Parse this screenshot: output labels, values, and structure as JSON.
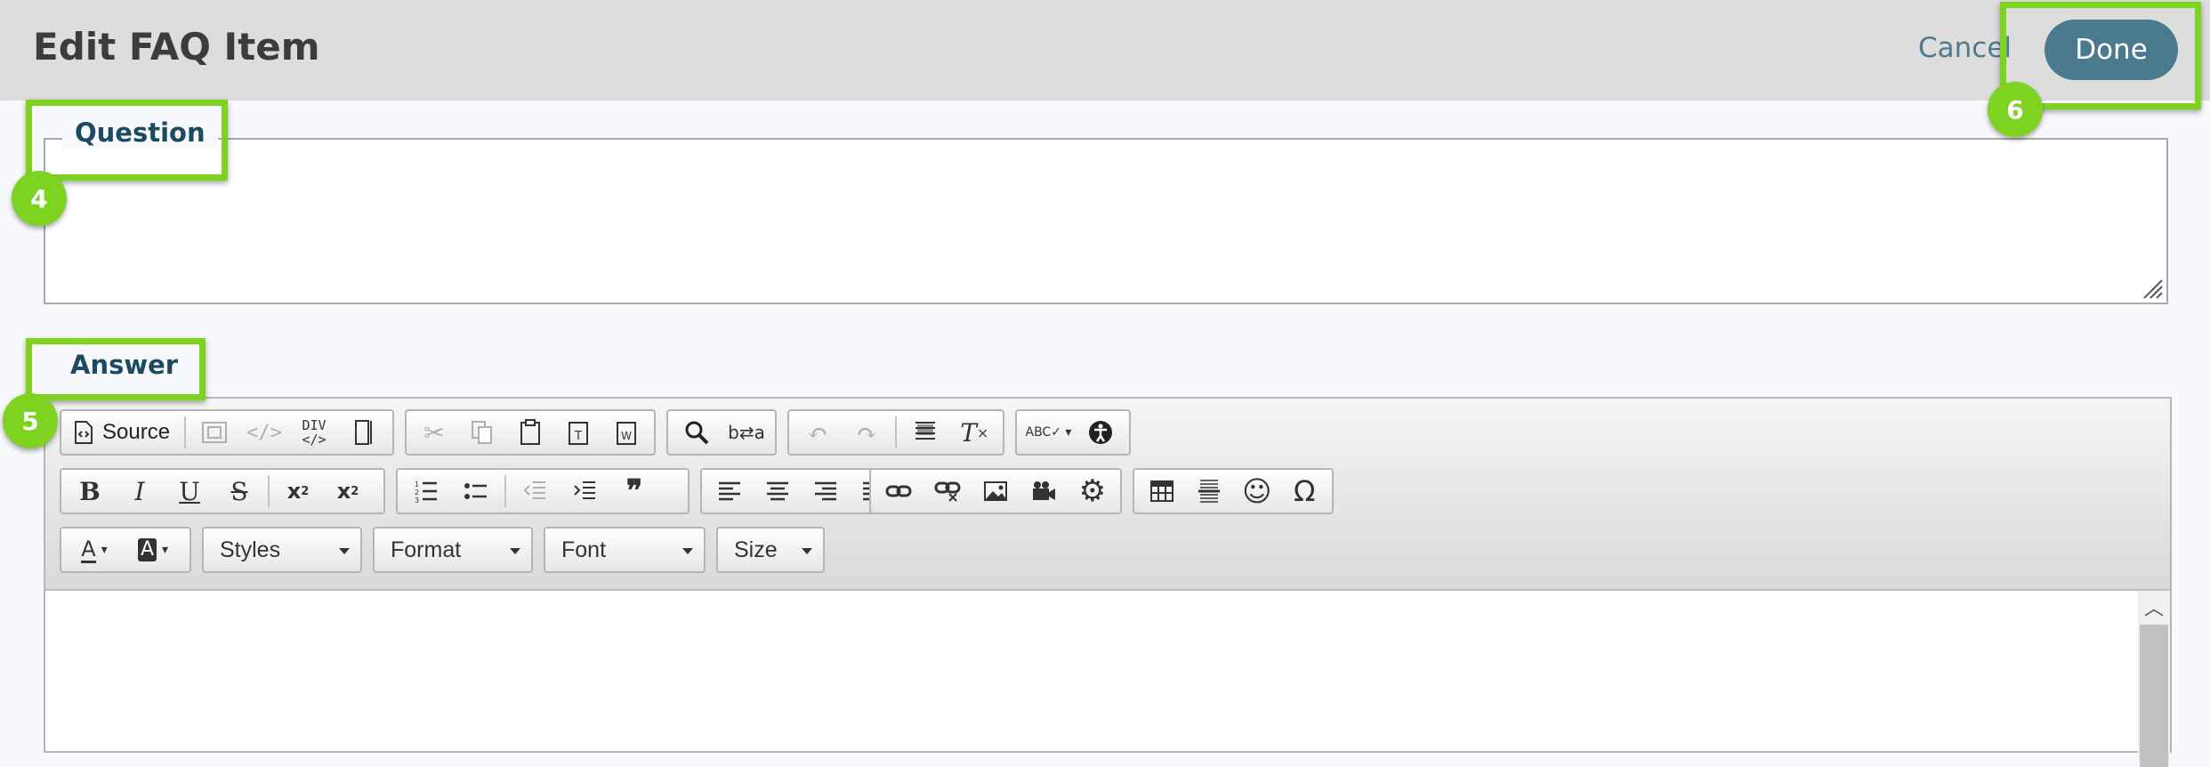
{
  "header": {
    "title": "Edit FAQ Item",
    "cancel_label": "Cancel",
    "done_label": "Done"
  },
  "question": {
    "legend": "Question",
    "value": ""
  },
  "answer": {
    "label": "Answer"
  },
  "callouts": {
    "question": "4",
    "answer": "5",
    "done": "6"
  },
  "toolbar": {
    "source_label": "Source",
    "combos": {
      "styles": "Styles",
      "format": "Format",
      "font": "Font",
      "size": "Size"
    },
    "glyphs": {
      "bold": "B",
      "italic": "I",
      "underline": "U",
      "strike": "S",
      "omega": "Ω",
      "smiley": "☺",
      "quote": "❞",
      "text_color": "A",
      "bg_color": "A"
    }
  },
  "colors": {
    "accent": "#4b7a8e",
    "callout": "#7ed321",
    "header_bg": "#dddddd"
  }
}
